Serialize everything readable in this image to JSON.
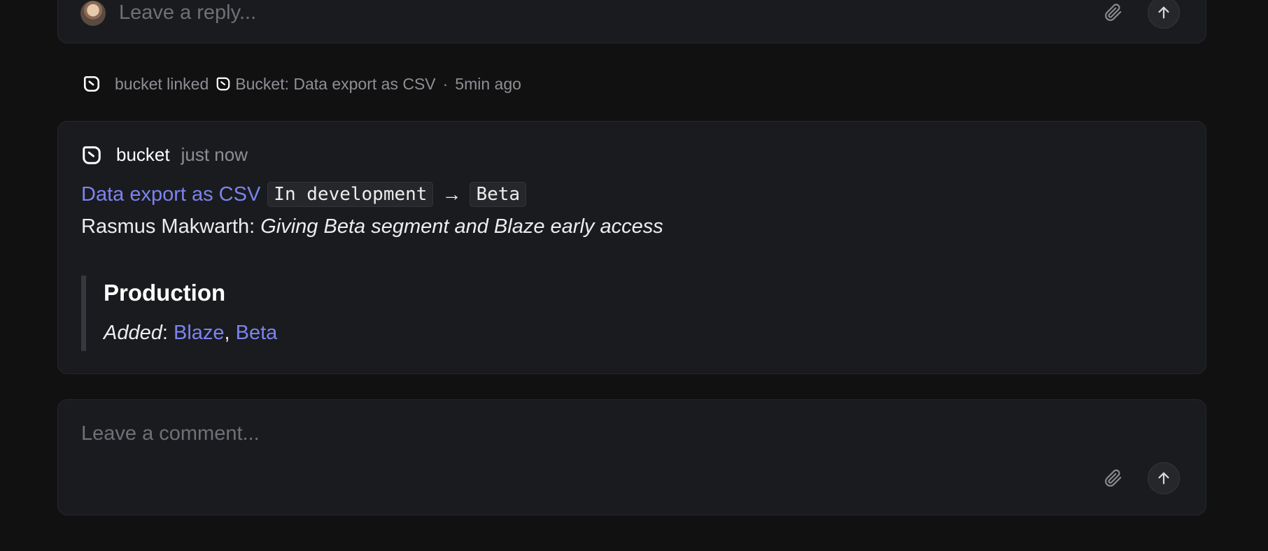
{
  "reply_box": {
    "placeholder": "Leave a reply...",
    "attach_icon": "paperclip-icon",
    "send_icon": "arrow-up-icon"
  },
  "activity": {
    "icon": "bucket-icon",
    "actor": "bucket",
    "verb": "linked",
    "linked_item": "Bucket: Data export as CSV",
    "separator": "·",
    "timestamp": "5min ago"
  },
  "event": {
    "icon": "bucket-icon",
    "author": "bucket",
    "timestamp": "just now",
    "feature_link": "Data export as CSV",
    "from_stage": "In development",
    "arrow": "→",
    "to_stage": "Beta",
    "note_author": "Rasmus Makwarth:",
    "note_text": "Giving Beta segment and Blaze early access",
    "quote": {
      "title": "Production",
      "added_label": "Added",
      "colon": ":",
      "items": [
        "Blaze",
        "Beta"
      ],
      "comma": ","
    }
  },
  "comment_box": {
    "placeholder": "Leave a comment...",
    "attach_icon": "paperclip-icon",
    "send_icon": "arrow-up-icon"
  },
  "colors": {
    "background": "#111112",
    "card": "#1a1b1e",
    "link": "#7c83f0",
    "muted": "#8e8f95"
  }
}
